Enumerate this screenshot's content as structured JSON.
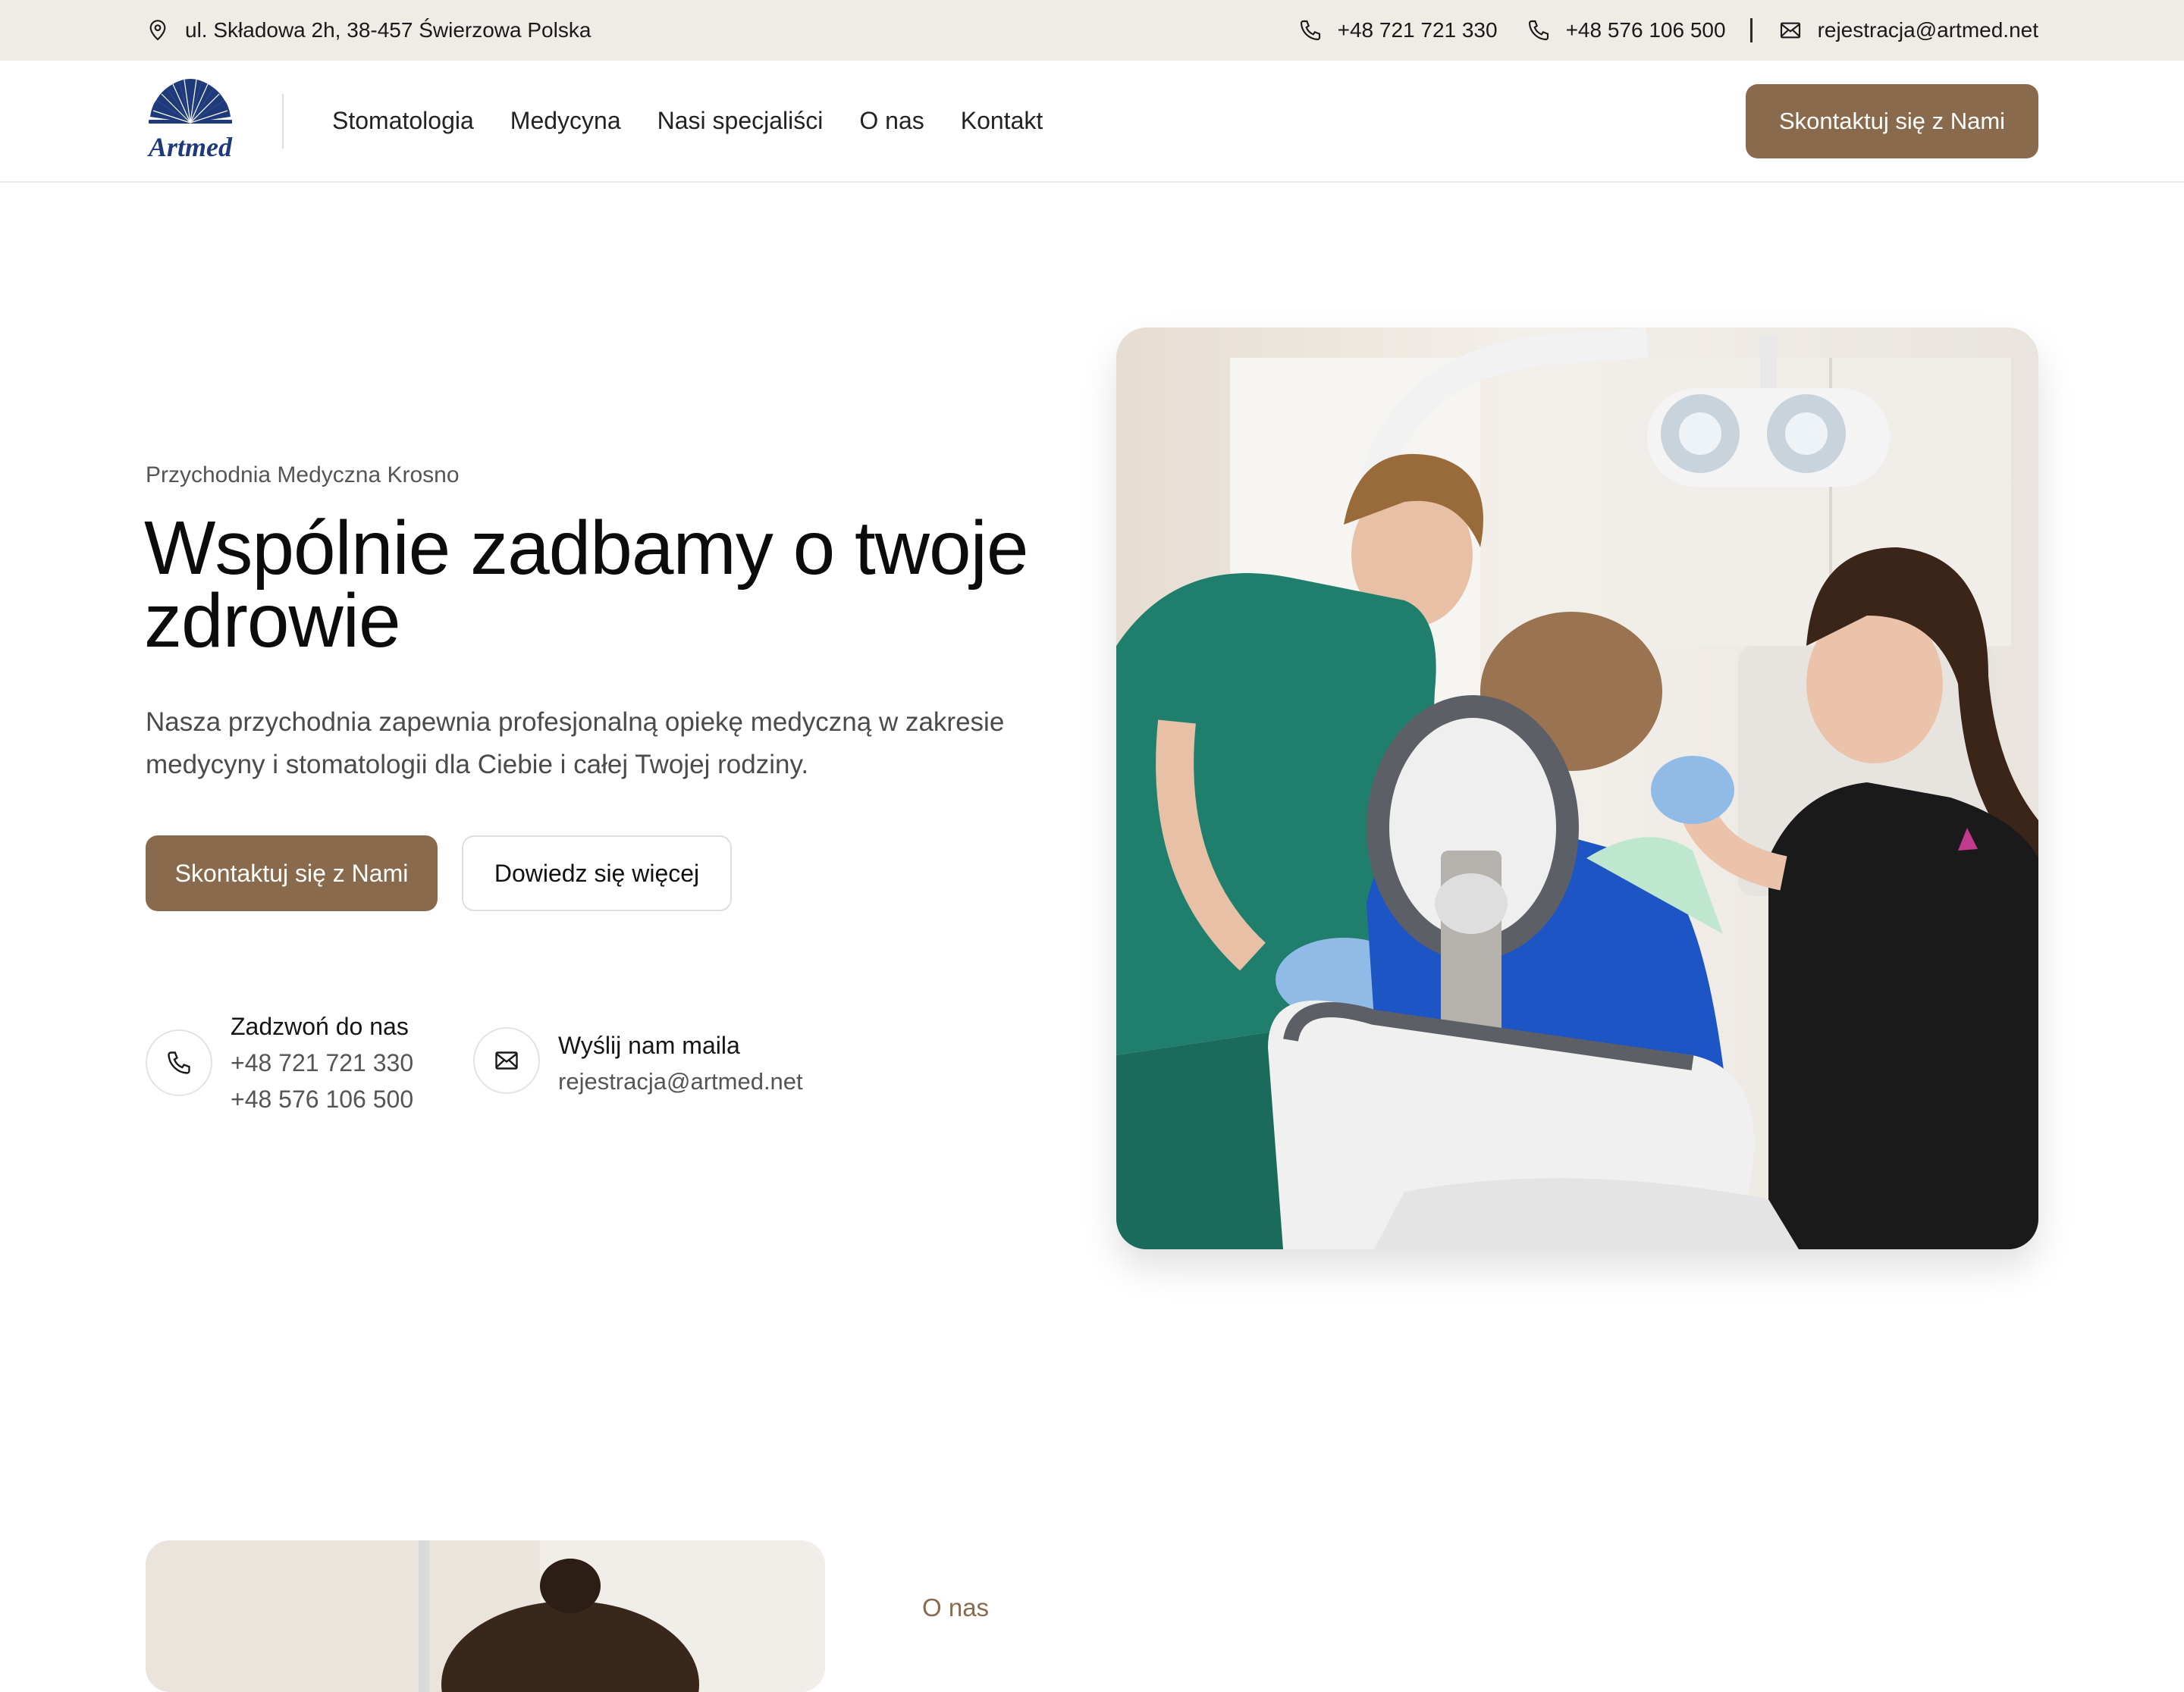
{
  "topbar": {
    "address": "ul. Składowa 2h, 38-457 Świerzowa Polska",
    "phone_1": "+48 721 721 330",
    "phone_2": "+48 576 106 500",
    "email": "rejestracja@artmed.net"
  },
  "header": {
    "logo_text": "Artmed",
    "nav": [
      "Stomatologia",
      "Medycyna",
      "Nasi specjaliści",
      "O nas",
      "Kontakt"
    ],
    "cta_label": "Skontaktuj się z Nami"
  },
  "hero": {
    "eyebrow": "Przychodnia Medyczna Krosno",
    "title": "Wspólnie zadbamy o twoje zdrowie",
    "description": "Nasza przychodnia zapewnia profesjonalną opiekę medyczną w zakresie medycyny i stomatologii dla Ciebie i całej Twojej rodziny.",
    "primary_button": "Skontaktuj się z Nami",
    "secondary_button": "Dowiedz się więcej",
    "call": {
      "title": "Zadzwoń do nas",
      "phone_1": "+48 721 721 330",
      "phone_2": "+48 576 106 500"
    },
    "mail": {
      "title": "Wyślij nam maila",
      "email": "rejestracja@artmed.net"
    }
  },
  "about": {
    "eyebrow": "O nas"
  },
  "colors": {
    "accent": "#8a6a4c",
    "topbar_bg": "#efebe5",
    "logo_blue": "#1f3a7a"
  },
  "icons": {
    "address": "map-pin-icon",
    "phone": "phone-icon",
    "email": "mail-icon"
  }
}
